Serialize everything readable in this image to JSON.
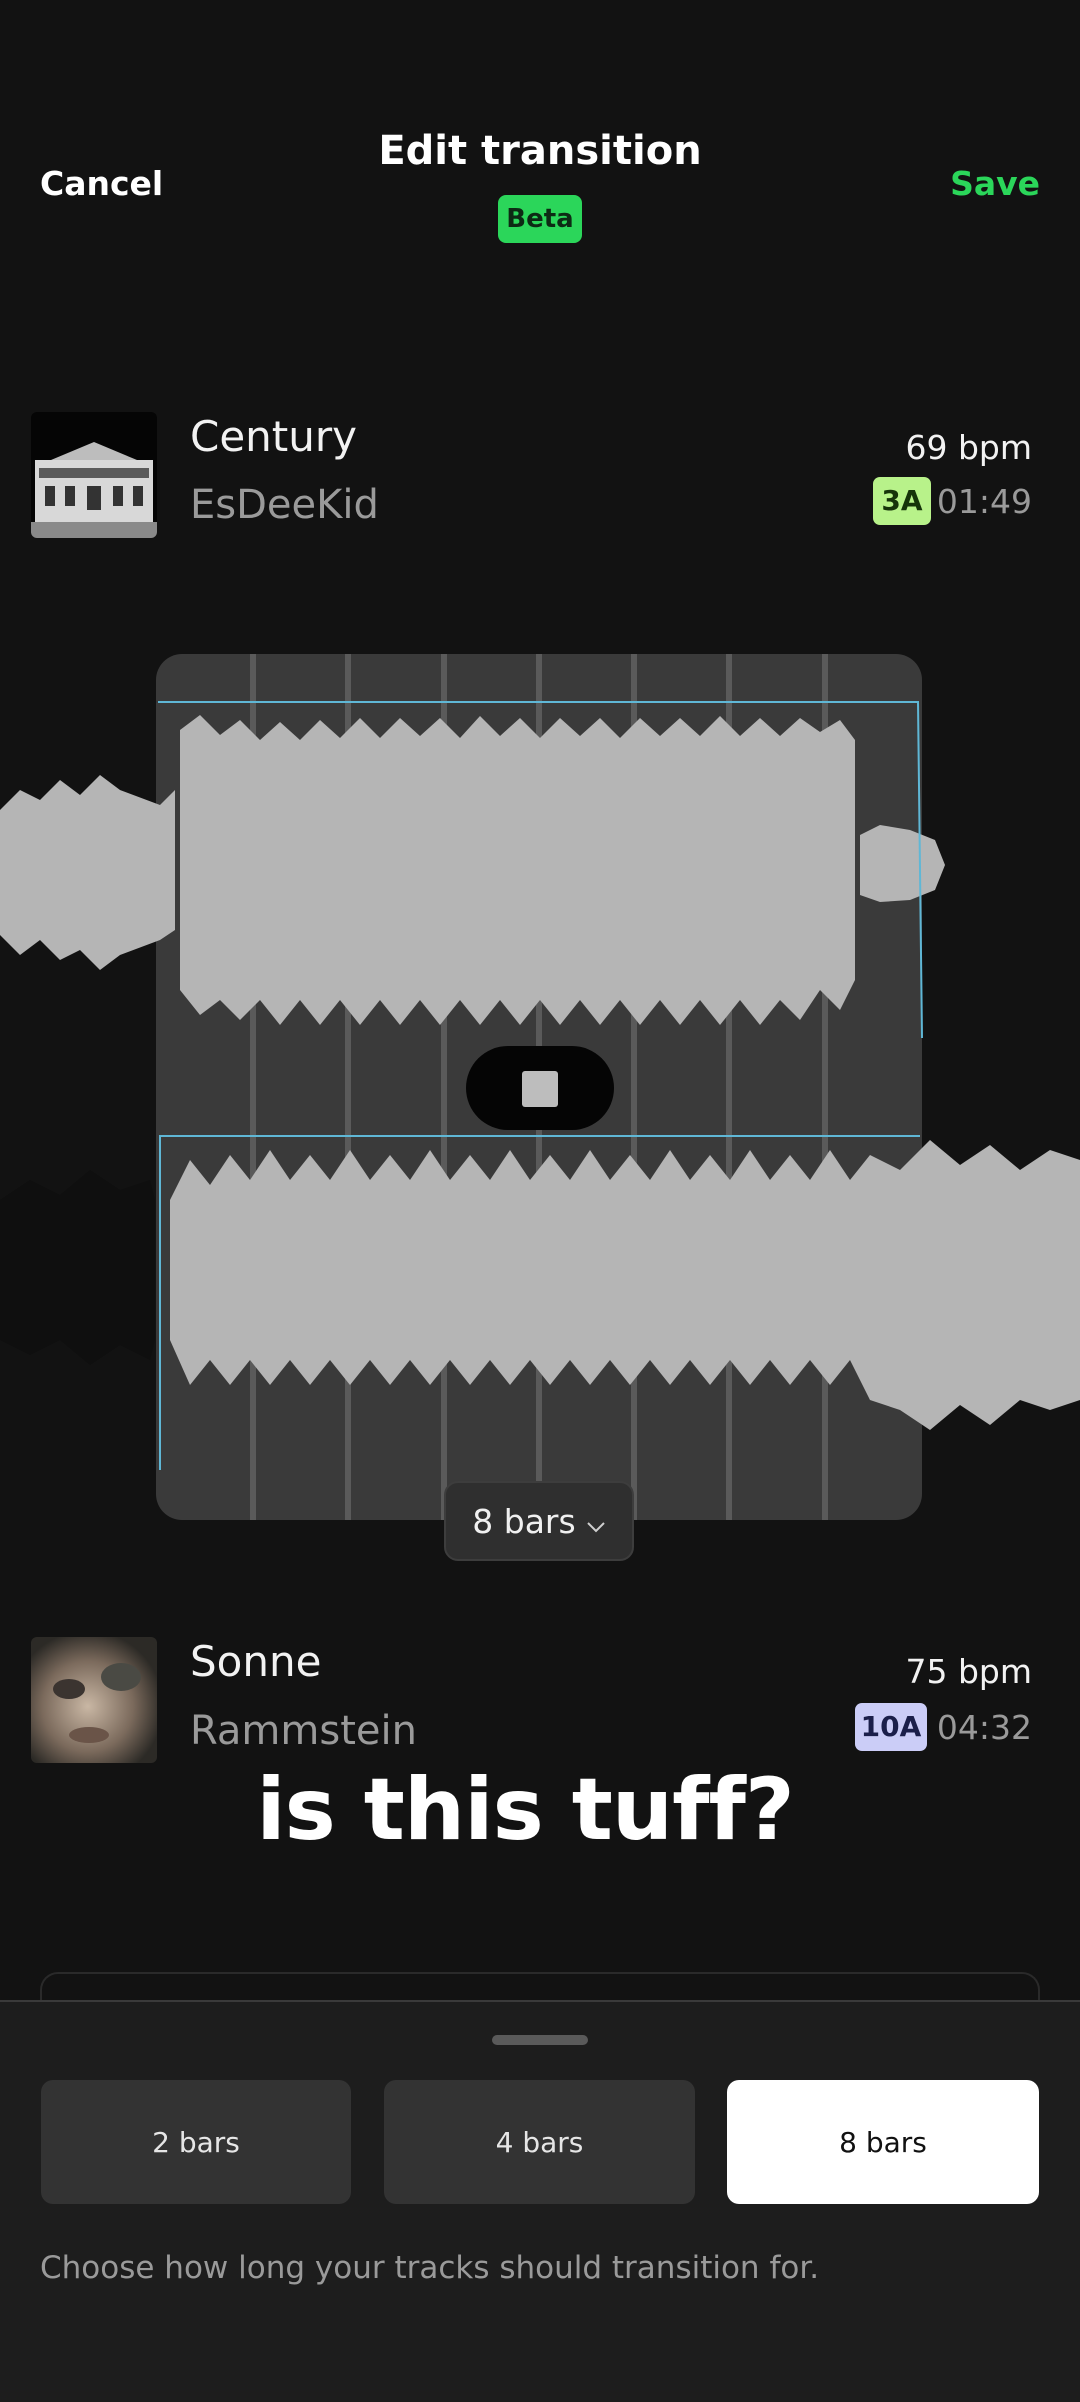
{
  "header": {
    "cancel_label": "Cancel",
    "title": "Edit transition",
    "badge": "Beta",
    "save_label": "Save"
  },
  "track_top": {
    "title": "Century",
    "artist": "EsDeeKid",
    "bpm": "69 bpm",
    "key": "3A",
    "duration": "01:49",
    "key_color": "#b8f28a"
  },
  "track_bottom": {
    "title": "Sonne",
    "artist": "Rammstein",
    "bpm": "75 bpm",
    "key": "10A",
    "duration": "04:32",
    "key_color": "#cbcdf7"
  },
  "transition": {
    "bars_selector_label": "8 bars"
  },
  "overlay_caption": "is this tuff?",
  "sheet": {
    "options": [
      "2 bars",
      "4 bars",
      "8 bars"
    ],
    "selected_index": 2,
    "hint": "Choose how long your tracks should transition for."
  },
  "colors": {
    "accent_green": "#2bd65a",
    "waveform_outline": "#5fb7d6",
    "background": "#121212"
  }
}
